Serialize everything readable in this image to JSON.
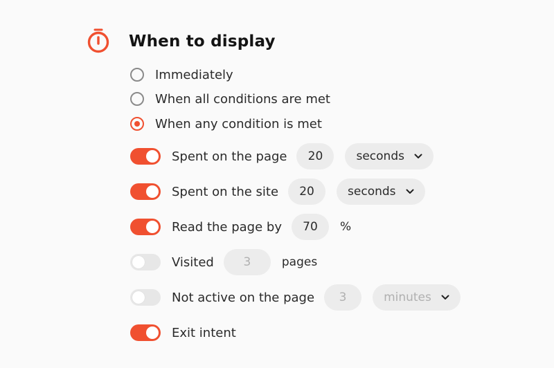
{
  "section": {
    "title": "When to display",
    "accent_color": "#f05030"
  },
  "radios": [
    {
      "label": "Immediately",
      "checked": false
    },
    {
      "label": "When all conditions are met",
      "checked": false
    },
    {
      "label": "When any condition is met",
      "checked": true
    }
  ],
  "conditions": [
    {
      "label": "Spent on the page",
      "enabled": true,
      "value": "20",
      "unit": "seconds"
    },
    {
      "label": "Spent on the site",
      "enabled": true,
      "value": "20",
      "unit": "seconds"
    },
    {
      "label": "Read the page by",
      "enabled": true,
      "value": "70",
      "unit": "%"
    },
    {
      "label": "Visited",
      "enabled": false,
      "value": "3",
      "unit": "pages"
    },
    {
      "label": "Not active on the page",
      "enabled": false,
      "value": "3",
      "unit": "minutes"
    },
    {
      "label": "Exit intent",
      "enabled": true
    }
  ],
  "icons": {
    "timer": "stopwatch-icon",
    "dropdown": "chevron-down-icon"
  }
}
